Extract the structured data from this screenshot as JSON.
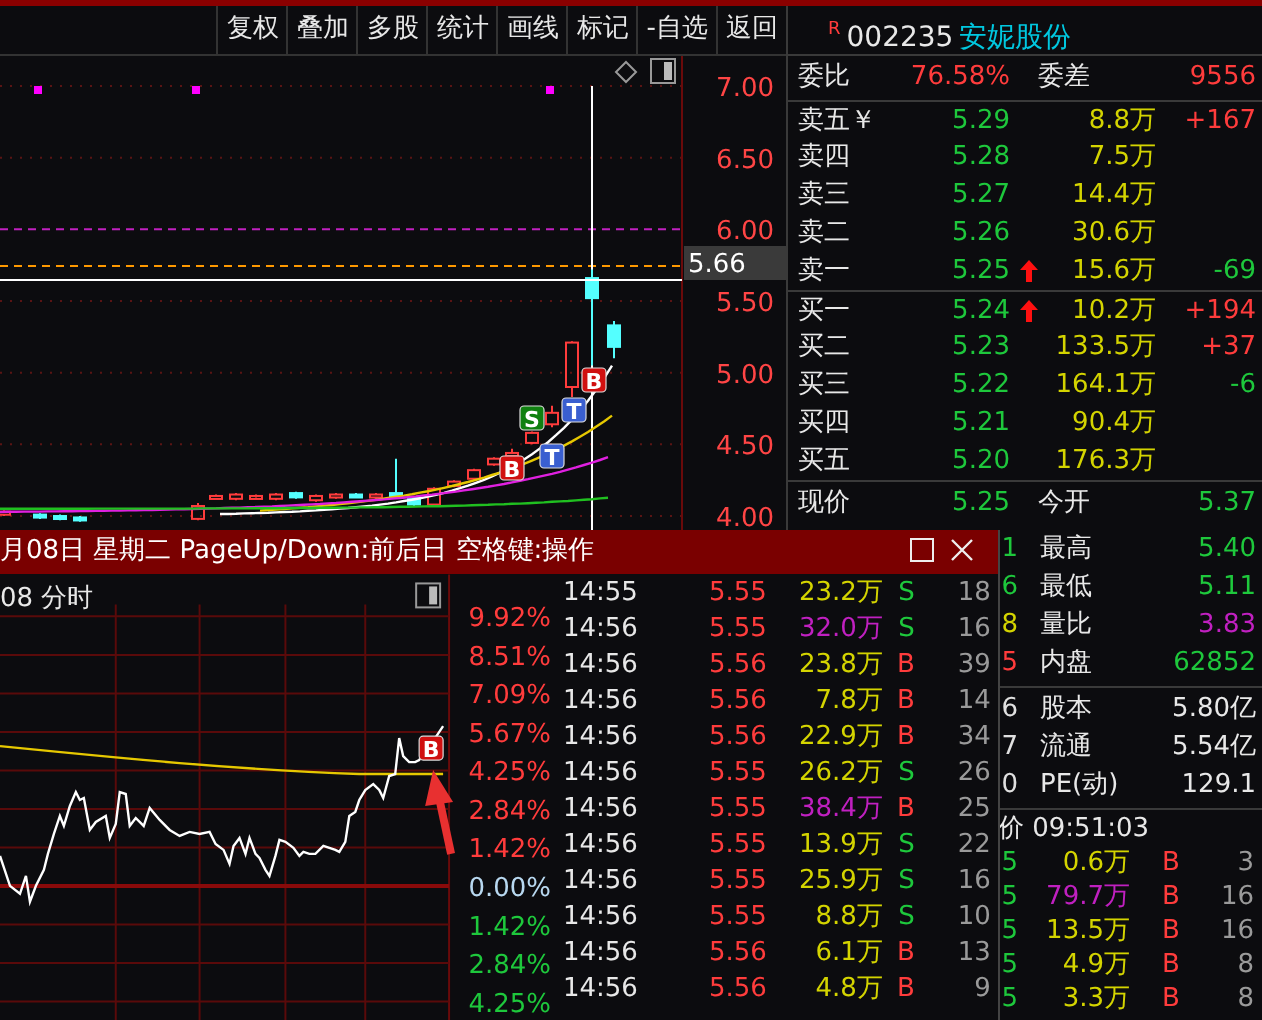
{
  "toolbar": {
    "buttons": [
      "复权",
      "叠加",
      "多股",
      "统计",
      "画线",
      "标记",
      "-自选",
      "返回"
    ]
  },
  "kline": {
    "price_labels": [
      "7.00",
      "6.50",
      "6.00",
      "5.50",
      "5.00",
      "4.50",
      "4.00"
    ],
    "crosshair_price": "5.66",
    "signals": [
      {
        "letter": "B",
        "kind": "buy"
      },
      {
        "letter": "S",
        "kind": "sell"
      },
      {
        "letter": "T",
        "kind": "t"
      },
      {
        "letter": "T",
        "kind": "t"
      },
      {
        "letter": "B",
        "kind": "buy"
      }
    ]
  },
  "quote": {
    "flag": "R",
    "code": "002235",
    "name": "安妮股份",
    "ratio": {
      "label": "委比",
      "value": "76.58%",
      "diff_label": "委差",
      "diff_value": "9556"
    },
    "asks": [
      {
        "label": "卖五￥",
        "price": "5.29",
        "arrow": false,
        "volume": "8.8万",
        "change": {
          "text": "+167",
          "color": "#ff3c3c"
        }
      },
      {
        "label": "卖四",
        "price": "5.28",
        "arrow": false,
        "volume": "7.5万"
      },
      {
        "label": "卖三",
        "price": "5.27",
        "arrow": false,
        "volume": "14.4万"
      },
      {
        "label": "卖二",
        "price": "5.26",
        "arrow": false,
        "volume": "30.6万"
      },
      {
        "label": "卖一",
        "price": "5.25",
        "arrow": true,
        "volume": "15.6万",
        "change": {
          "text": "-69",
          "color": "#1ec83c"
        }
      }
    ],
    "bids": [
      {
        "label": "买一",
        "price": "5.24",
        "arrow": true,
        "volume": "10.2万",
        "change": {
          "text": "+194",
          "color": "#ff3c3c"
        }
      },
      {
        "label": "买二",
        "price": "5.23",
        "arrow": false,
        "volume": "133.5万",
        "change": {
          "text": "+37",
          "color": "#ff3c3c"
        }
      },
      {
        "label": "买三",
        "price": "5.22",
        "arrow": false,
        "volume": "164.1万",
        "change": {
          "text": "-6",
          "color": "#1ec83c"
        }
      },
      {
        "label": "买四",
        "price": "5.21",
        "arrow": false,
        "volume": "90.4万"
      },
      {
        "label": "买五",
        "price": "5.20",
        "arrow": false,
        "volume": "176.3万"
      }
    ],
    "summary": [
      {
        "label": "现价",
        "value": "5.25",
        "color": "#1ec83c"
      },
      {
        "label": "今开",
        "value": "5.37",
        "color": "#1ec83c"
      }
    ],
    "stats": [
      {
        "fragment": {
          "text": "1",
          "color": "#1ec83c"
        },
        "label": "最高",
        "value": "5.40",
        "color": "#1ec83c"
      },
      {
        "fragment": {
          "text": "6",
          "color": "#1ec83c"
        },
        "label": "最低",
        "value": "5.11",
        "color": "#1ec83c"
      },
      {
        "fragment": {
          "text": "8",
          "color": "#d4d400"
        },
        "label": "量比",
        "value": "3.83",
        "color": "#c020c0"
      },
      {
        "fragment": {
          "text": "5",
          "color": "#ff3c3c"
        },
        "label": "内盘",
        "value": "62852",
        "color": "#1ec83c"
      }
    ],
    "capital": [
      {
        "fragment": {
          "text": "6",
          "color": "#e0e0e0"
        },
        "label": "股本",
        "value": "5.80亿",
        "color": "#e8e8e8"
      },
      {
        "fragment": {
          "text": "7",
          "color": "#e0e0e0"
        },
        "label": "流通",
        "value": "5.54亿",
        "color": "#e8e8e8"
      },
      {
        "fragment": {
          "text": "0",
          "color": "#e0e0e0"
        },
        "label": "PE(动)",
        "value": "129.1",
        "color": "#e8e8e8"
      }
    ],
    "tick_header": "价 09:51:03",
    "ticks": [
      {
        "fragment": "5",
        "volume": "0.6万",
        "large": false,
        "side": "B",
        "kind": "buy",
        "count": "3"
      },
      {
        "fragment": "5",
        "volume": "79.7万",
        "large": true,
        "side": "B",
        "kind": "buy",
        "count": "16"
      },
      {
        "fragment": "5",
        "volume": "13.5万",
        "large": false,
        "side": "B",
        "kind": "buy",
        "count": "16"
      },
      {
        "fragment": "5",
        "volume": "4.9万",
        "large": false,
        "side": "B",
        "kind": "buy",
        "count": "8"
      },
      {
        "fragment": "5",
        "volume": "3.3万",
        "large": false,
        "side": "B",
        "kind": "buy",
        "count": "8"
      }
    ]
  },
  "popup": {
    "title": "月08日 星期二 PageUp/Down:前后日 空格键:操作",
    "chart_label": "08 分时",
    "percent_labels": [
      {
        "text": "9.92%",
        "color": "#ff3c3c"
      },
      {
        "text": "8.51%",
        "color": "#ff3c3c"
      },
      {
        "text": "7.09%",
        "color": "#ff3c3c"
      },
      {
        "text": "5.67%",
        "color": "#ff3c3c"
      },
      {
        "text": "4.25%",
        "color": "#ff3c3c"
      },
      {
        "text": "2.84%",
        "color": "#ff3c3c"
      },
      {
        "text": "1.42%",
        "color": "#ff3c3c"
      },
      {
        "text": "0.00%",
        "color": "#b8d8f0"
      },
      {
        "text": "1.42%",
        "color": "#1ec83c"
      },
      {
        "text": "2.84%",
        "color": "#1ec83c"
      },
      {
        "text": "4.25%",
        "color": "#1ec83c"
      }
    ],
    "signal": {
      "letter": "B",
      "kind": "buy"
    },
    "ticks": [
      {
        "time": "14:55",
        "price": "5.55",
        "volume": "23.2万",
        "large": false,
        "side": "S",
        "kind": "sell",
        "count": "18"
      },
      {
        "time": "14:56",
        "price": "5.55",
        "volume": "32.0万",
        "large": true,
        "side": "S",
        "kind": "sell",
        "count": "16"
      },
      {
        "time": "14:56",
        "price": "5.56",
        "volume": "23.8万",
        "large": false,
        "side": "B",
        "kind": "buy",
        "count": "39"
      },
      {
        "time": "14:56",
        "price": "5.56",
        "volume": "7.8万",
        "large": false,
        "side": "B",
        "kind": "buy",
        "count": "14"
      },
      {
        "time": "14:56",
        "price": "5.56",
        "volume": "22.9万",
        "large": false,
        "side": "B",
        "kind": "buy",
        "count": "34"
      },
      {
        "time": "14:56",
        "price": "5.55",
        "volume": "26.2万",
        "large": false,
        "side": "S",
        "kind": "sell",
        "count": "26"
      },
      {
        "time": "14:56",
        "price": "5.55",
        "volume": "38.4万",
        "large": true,
        "side": "B",
        "kind": "buy",
        "count": "25"
      },
      {
        "time": "14:56",
        "price": "5.55",
        "volume": "13.9万",
        "large": false,
        "side": "S",
        "kind": "sell",
        "count": "22"
      },
      {
        "time": "14:56",
        "price": "5.55",
        "volume": "25.9万",
        "large": false,
        "side": "S",
        "kind": "sell",
        "count": "16"
      },
      {
        "time": "14:56",
        "price": "5.55",
        "volume": "8.8万",
        "large": false,
        "side": "S",
        "kind": "sell",
        "count": "10"
      },
      {
        "time": "14:56",
        "price": "5.56",
        "volume": "6.1万",
        "large": false,
        "side": "B",
        "kind": "buy",
        "count": "13"
      },
      {
        "time": "14:56",
        "price": "5.56",
        "volume": "4.8万",
        "large": false,
        "side": "B",
        "kind": "buy",
        "count": "9"
      }
    ]
  }
}
